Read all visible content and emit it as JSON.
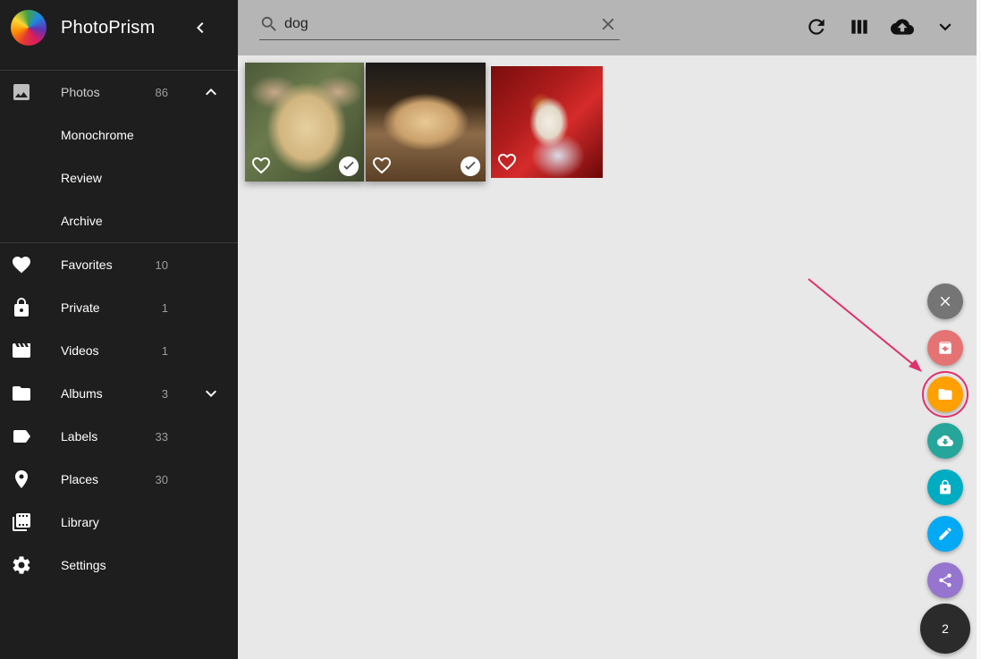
{
  "app": {
    "title": "PhotoPrism"
  },
  "sidebar": {
    "items": [
      {
        "label": "Photos",
        "count": "86",
        "icon": "image-icon",
        "expanded": true
      },
      {
        "label": "Monochrome"
      },
      {
        "label": "Review"
      },
      {
        "label": "Archive"
      },
      {
        "label": "Favorites",
        "count": "10",
        "icon": "heart-icon"
      },
      {
        "label": "Private",
        "count": "1",
        "icon": "lock-icon"
      },
      {
        "label": "Videos",
        "count": "1",
        "icon": "movie-icon"
      },
      {
        "label": "Albums",
        "count": "3",
        "icon": "folder-icon"
      },
      {
        "label": "Labels",
        "count": "33",
        "icon": "label-icon"
      },
      {
        "label": "Places",
        "count": "30",
        "icon": "place-icon"
      },
      {
        "label": "Library",
        "icon": "library-icon"
      },
      {
        "label": "Settings",
        "icon": "gear-icon"
      }
    ]
  },
  "search": {
    "value": "dog"
  },
  "toolbar": {
    "icons": [
      "refresh-icon",
      "view-column-icon",
      "cloud-upload-icon",
      "chevron-down-icon"
    ]
  },
  "photos": [
    {
      "selected": true,
      "favorite": false
    },
    {
      "selected": true,
      "favorite": false
    },
    {
      "selected": false,
      "favorite": false
    }
  ],
  "speed_dial": {
    "actions": [
      "close-icon",
      "archive-icon",
      "folder-icon",
      "cloud-download-icon",
      "lock-icon",
      "edit-icon",
      "share-icon"
    ],
    "selection_count": "2",
    "colors": {
      "close": "#757575",
      "archive": "#e57373",
      "album": "#ffa000",
      "download": "#26a69a",
      "private": "#00acc1",
      "edit": "#03a9f4",
      "share": "#9575cd",
      "annotation": "#e0306d"
    }
  }
}
